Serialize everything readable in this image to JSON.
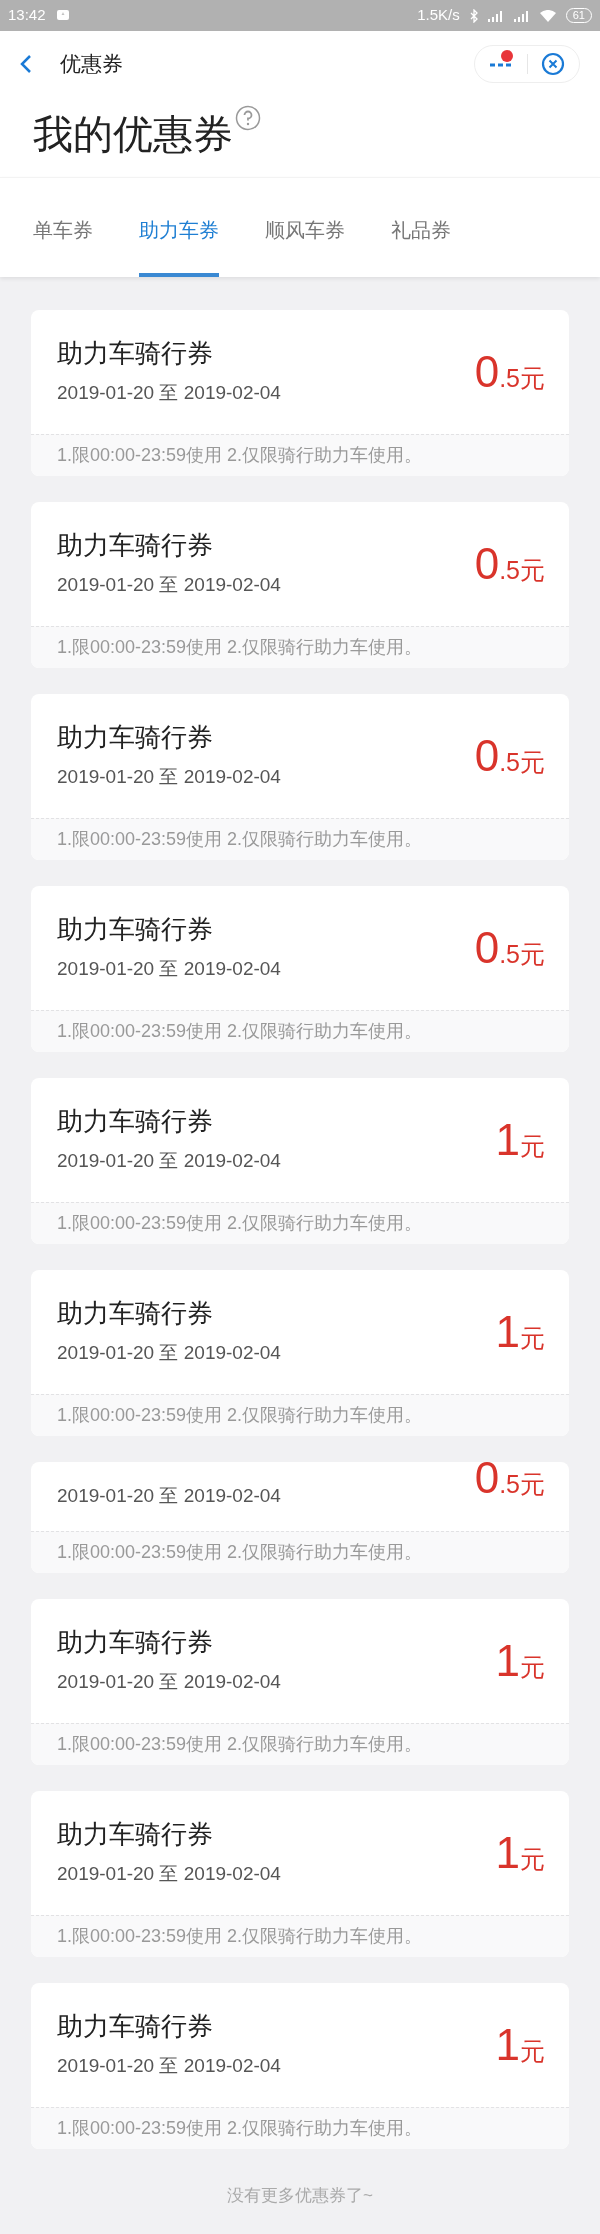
{
  "status_bar": {
    "time": "13:42",
    "speed": "1.5K/s",
    "battery": "61"
  },
  "header": {
    "title": "优惠券",
    "menu_badge": true
  },
  "page_title": "我的优惠券",
  "tabs": [
    {
      "label": "单车券",
      "selected": false
    },
    {
      "label": "助力车券",
      "selected": true
    },
    {
      "label": "顺风车券",
      "selected": false
    },
    {
      "label": "礼品券",
      "selected": false
    }
  ],
  "coupons": [
    {
      "kind": "full",
      "title": "助力车骑行券",
      "dates": "2019-01-20 至 2019-02-04",
      "amount_main": "0",
      "amount_rest": ".5元",
      "rules": "1.限00:00-23:59使用 2.仅限骑行助力车使用。"
    },
    {
      "kind": "full",
      "title": "助力车骑行券",
      "dates": "2019-01-20 至 2019-02-04",
      "amount_main": "0",
      "amount_rest": ".5元",
      "rules": "1.限00:00-23:59使用 2.仅限骑行助力车使用。"
    },
    {
      "kind": "full",
      "title": "助力车骑行券",
      "dates": "2019-01-20 至 2019-02-04",
      "amount_main": "0",
      "amount_rest": ".5元",
      "rules": "1.限00:00-23:59使用 2.仅限骑行助力车使用。"
    },
    {
      "kind": "full",
      "title": "助力车骑行券",
      "dates": "2019-01-20 至 2019-02-04",
      "amount_main": "0",
      "amount_rest": ".5元",
      "rules": "1.限00:00-23:59使用 2.仅限骑行助力车使用。"
    },
    {
      "kind": "full",
      "title": "助力车骑行券",
      "dates": "2019-01-20 至 2019-02-04",
      "amount_main": "1",
      "amount_rest": "元",
      "rules": "1.限00:00-23:59使用 2.仅限骑行助力车使用。"
    },
    {
      "kind": "full",
      "title": "助力车骑行券",
      "dates": "2019-01-20 至 2019-02-04",
      "amount_main": "1",
      "amount_rest": "元",
      "rules": "1.限00:00-23:59使用 2.仅限骑行助力车使用。"
    },
    {
      "kind": "partial",
      "dates": "2019-01-20 至 2019-02-04",
      "amount_main": "0",
      "amount_rest": ".5元",
      "rules": "1.限00:00-23:59使用 2.仅限骑行助力车使用。"
    },
    {
      "kind": "full",
      "title": "助力车骑行券",
      "dates": "2019-01-20 至 2019-02-04",
      "amount_main": "1",
      "amount_rest": "元",
      "rules": "1.限00:00-23:59使用 2.仅限骑行助力车使用。"
    },
    {
      "kind": "full",
      "title": "助力车骑行券",
      "dates": "2019-01-20 至 2019-02-04",
      "amount_main": "1",
      "amount_rest": "元",
      "rules": "1.限00:00-23:59使用 2.仅限骑行助力车使用。"
    },
    {
      "kind": "full",
      "title": "助力车骑行券",
      "dates": "2019-01-20 至 2019-02-04",
      "amount_main": "1",
      "amount_rest": "元",
      "rules": "1.限00:00-23:59使用 2.仅限骑行助力车使用。"
    }
  ],
  "footer": "没有更多优惠券了~"
}
